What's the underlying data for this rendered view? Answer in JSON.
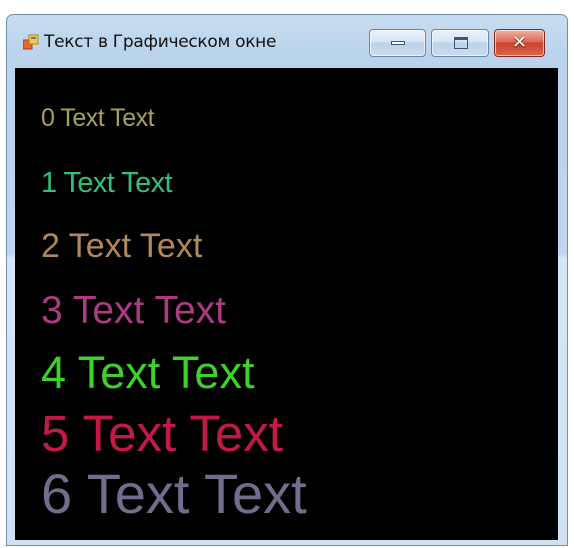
{
  "window": {
    "title": "Текст в Графическом окне",
    "controls": {
      "minimize": "minimize",
      "maximize": "maximize",
      "close": "✕"
    }
  },
  "canvas": {
    "background": "#000000",
    "lines": [
      {
        "text": "0 Text Text",
        "color": "#a9a05d"
      },
      {
        "text": "1 Text Text",
        "color": "#2fc07a"
      },
      {
        "text": "2 Text Text",
        "color": "#b08a58"
      },
      {
        "text": "3 Text Text",
        "color": "#ac3b83"
      },
      {
        "text": "4 Text Text",
        "color": "#3cd22a"
      },
      {
        "text": "5 Text Text",
        "color": "#c21a46"
      },
      {
        "text": "6 Text Text",
        "color": "#6f6e8c"
      }
    ]
  }
}
